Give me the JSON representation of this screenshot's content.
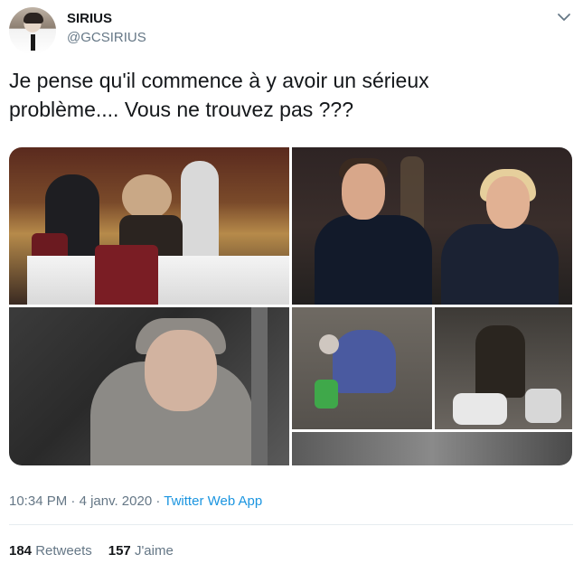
{
  "user": {
    "display_name": "SIRIUS",
    "handle": "@GCSIRIUS"
  },
  "tweet": {
    "text_line1": "Je pense qu'il commence à y avoir un sérieux",
    "text_line2": "problème.... Vous ne trouvez pas ???"
  },
  "meta": {
    "time": "10:34 PM",
    "separator": "·",
    "date": "4 janv. 2020",
    "app": "Twitter Web App"
  },
  "stats": {
    "retweets_count": "184",
    "retweets_label": "Retweets",
    "likes_count": "157",
    "likes_label": "J'aime"
  },
  "icons": {
    "menu": "chevron-down-icon"
  },
  "colors": {
    "link": "#1b95e0",
    "muted": "#657786",
    "text": "#14171a"
  }
}
